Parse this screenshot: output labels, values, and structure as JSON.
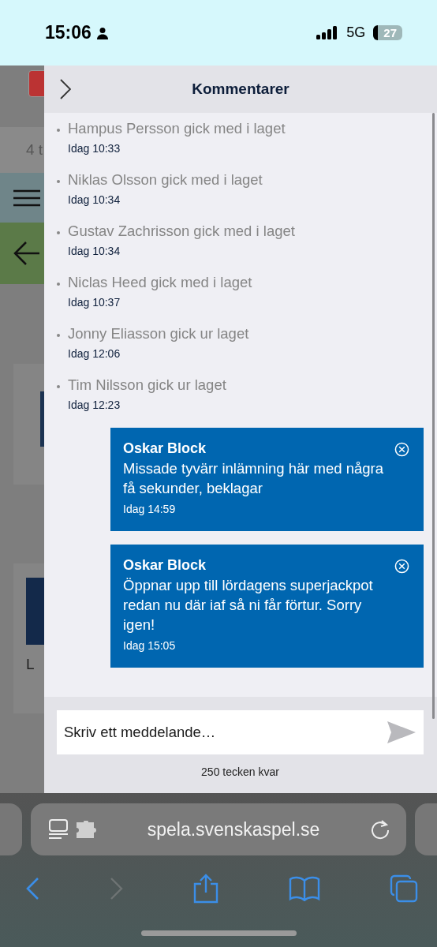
{
  "status_bar": {
    "time": "15:06",
    "network": "5G",
    "battery": "27"
  },
  "background": {
    "texts": [
      "4 t",
      "L"
    ]
  },
  "panel": {
    "title": "Kommentarer"
  },
  "events": [
    {
      "text": "Hampus Persson gick med i laget",
      "time": "Idag 10:33"
    },
    {
      "text": "Niklas Olsson gick med i laget",
      "time": "Idag 10:34"
    },
    {
      "text": "Gustav Zachrisson gick med i laget",
      "time": "Idag 10:34"
    },
    {
      "text": "Niclas Heed gick med i laget",
      "time": "Idag 10:37"
    },
    {
      "text": "Jonny Eliasson gick ur laget",
      "time": "Idag 12:06"
    },
    {
      "text": "Tim Nilsson gick ur laget",
      "time": "Idag 12:23"
    }
  ],
  "messages": [
    {
      "author": "Oskar Block",
      "text": "Missade tyvärr inlämning här med några få sekunder, beklagar",
      "time": "Idag 14:59"
    },
    {
      "author": "Oskar Block",
      "text": "Öppnar upp till lördagens superjackpot redan nu där iaf så ni får förtur. Sorry igen!",
      "time": "Idag 15:05"
    }
  ],
  "composer": {
    "placeholder": "Skriv ett meddelande…",
    "counter": "250 tecken kvar"
  },
  "browser": {
    "url": "spela.svenskaspel.se"
  }
}
